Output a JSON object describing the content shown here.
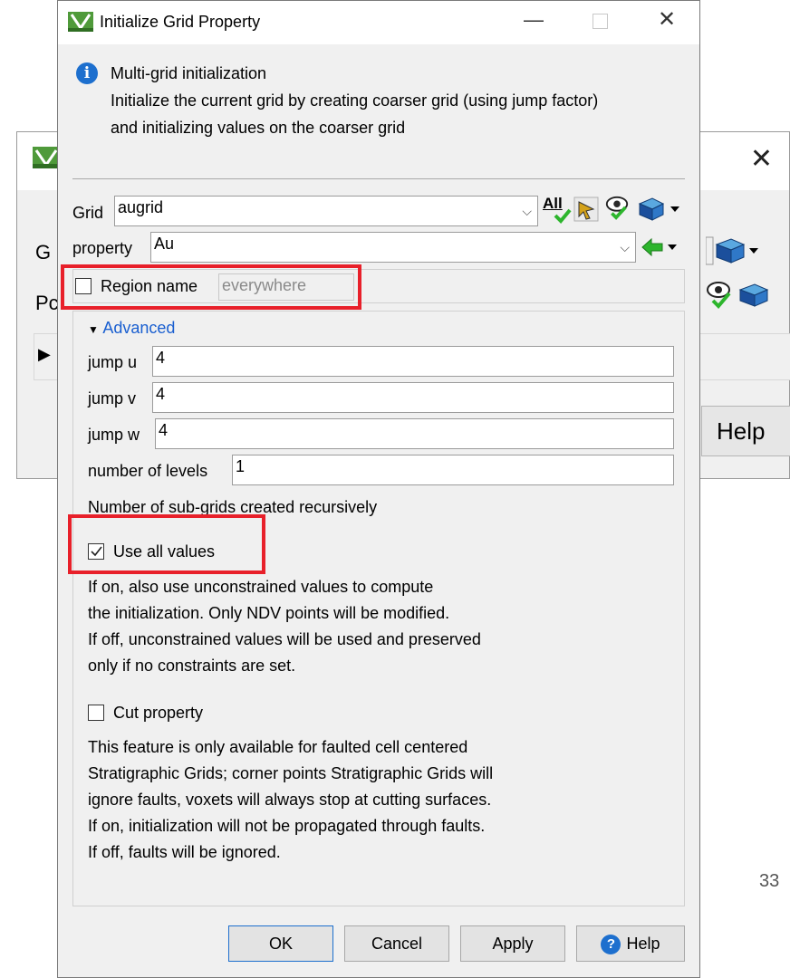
{
  "background_dialog": {
    "label_g": "G",
    "label_p": "Pc",
    "help_label": "Help"
  },
  "dialog": {
    "title": "Initialize Grid Property",
    "info": {
      "heading": "Multi-grid initialization",
      "line1": "Initialize the current grid by creating coarser grid (using jump factor)",
      "line2": "and initializing values on the coarser grid"
    },
    "grid": {
      "label": "Grid",
      "value": "augrid",
      "all_label": "All"
    },
    "property": {
      "label": "property",
      "value": "Au"
    },
    "region": {
      "label": "Region name",
      "placeholder": "everywhere",
      "checked": false
    },
    "advanced": {
      "label": "Advanced",
      "jump_u": {
        "label": "jump u",
        "value": "4"
      },
      "jump_v": {
        "label": "jump v",
        "value": "4"
      },
      "jump_w": {
        "label": "jump w",
        "value": "4"
      },
      "levels": {
        "label": "number of levels",
        "value": "1"
      },
      "levels_desc": "Number of sub-grids created recursively",
      "use_all": {
        "label": "Use all values",
        "checked": true,
        "desc": [
          "If on, also use unconstrained values to compute",
          "the initialization. Only NDV points will be modified.",
          "If off, unconstrained values will be used and preserved",
          "only if no constraints are set."
        ]
      },
      "cut": {
        "label": "Cut property",
        "checked": false,
        "desc": [
          "This feature is only available for faulted cell centered",
          "Stratigraphic Grids; corner points Stratigraphic Grids will",
          "ignore faults, voxets will always stop at cutting surfaces.",
          "If on, initialization will not be propagated through faults.",
          "If off, faults will be ignored."
        ]
      }
    },
    "buttons": {
      "ok": "OK",
      "cancel": "Cancel",
      "apply": "Apply",
      "help": "Help"
    }
  },
  "page_number": "33",
  "colors": {
    "accent": "#1d6fce",
    "highlight": "#e8202a",
    "link": "#1a5fd0",
    "check_green": "#2db52d"
  }
}
